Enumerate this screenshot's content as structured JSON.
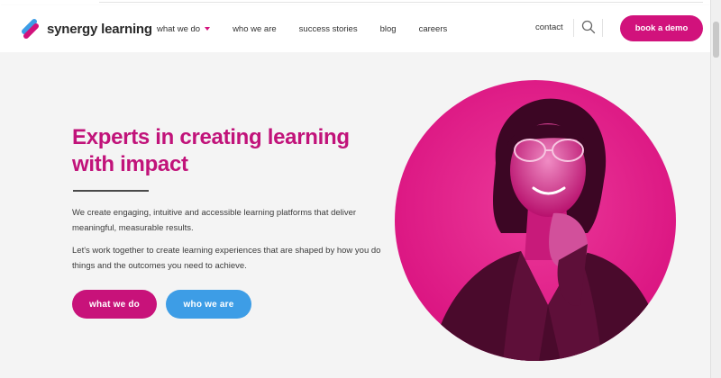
{
  "brand": {
    "name": "synergy learning",
    "colors": {
      "magenta": "#d1127c",
      "blue": "#3d9de6"
    }
  },
  "nav": {
    "items": [
      {
        "label": "what we do",
        "has_dropdown": true
      },
      {
        "label": "who we are"
      },
      {
        "label": "success stories"
      },
      {
        "label": "blog"
      },
      {
        "label": "careers"
      }
    ],
    "contact_label": "contact",
    "search_icon": "search-icon",
    "demo_label": "book a demo"
  },
  "hero": {
    "title": "Experts in creating learning with impact",
    "paragraph1": "We create engaging, intuitive and accessible learning platforms that deliver meaningful, measurable results.",
    "paragraph2": "Let's work together to create learning experiences that are shaped by how you do things and the outcomes you need to achieve.",
    "primary_button": "what we do",
    "secondary_button": "who we are",
    "image": "portrait of smiling woman with glasses, magenta duotone, circular crop"
  }
}
